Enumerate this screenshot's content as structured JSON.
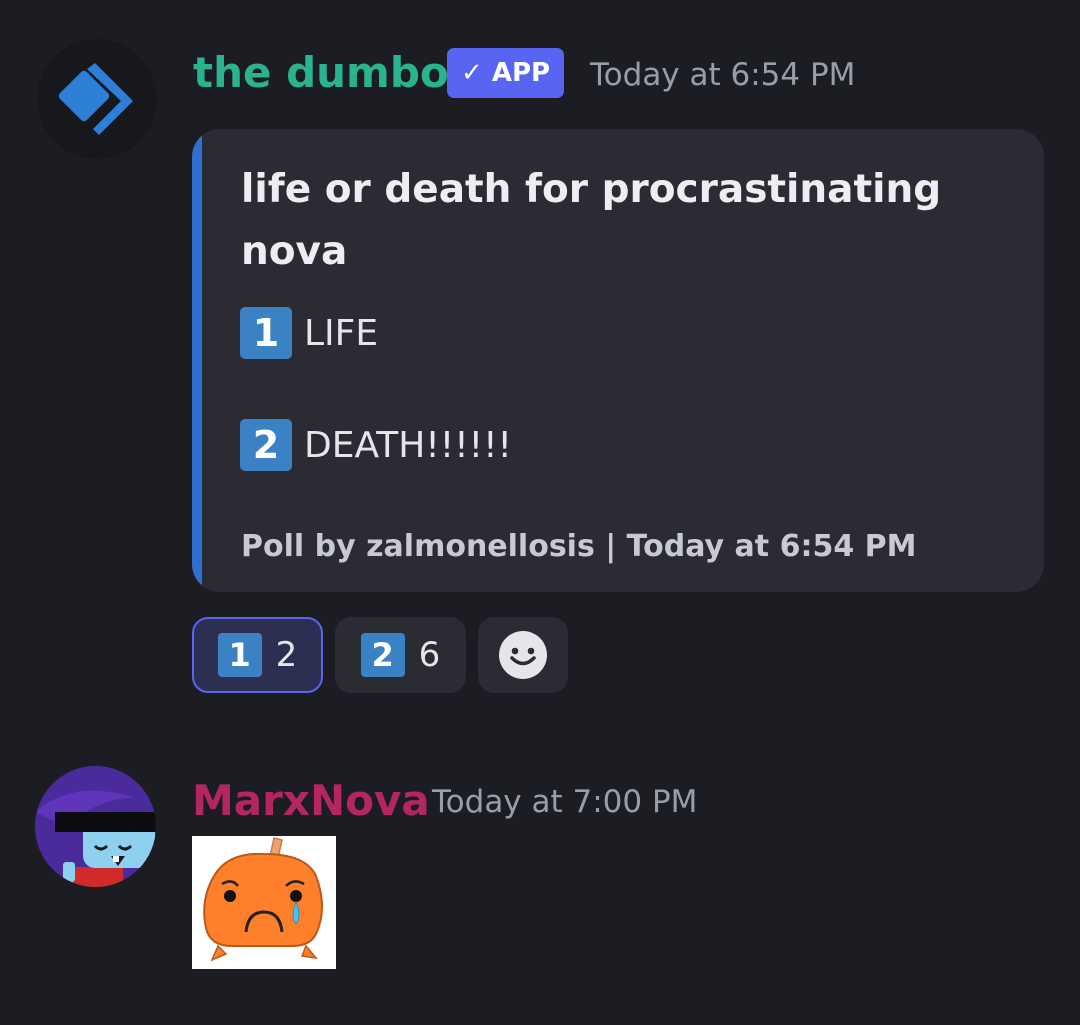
{
  "messages": [
    {
      "author": "the dumbot",
      "author_color": "#2ab391",
      "badge": "APP",
      "badge_icon": "check-icon",
      "timestamp": "Today at 6:54 PM",
      "avatar_icon": "chevron-diamond-icon",
      "embed": {
        "accent_color": "#2f6fd0",
        "title": "life or death for procrastinating nova",
        "options": [
          {
            "keycap": "1",
            "label": "LIFE"
          },
          {
            "keycap": "2",
            "label": "DEATH!!!!!!"
          }
        ],
        "footer": "Poll by zalmonellosis | Today at 6:54 PM"
      },
      "reactions": [
        {
          "keycap": "1",
          "count": "2",
          "selected": true
        },
        {
          "keycap": "2",
          "count": "6",
          "selected": false
        },
        {
          "icon": "add-reaction-smiley-icon"
        }
      ]
    },
    {
      "author": "MarxNova",
      "author_color": "#b3275e",
      "timestamp": "Today at 7:00 PM",
      "avatar_icon": "cartoon-avatar",
      "attachment": {
        "type": "sticker",
        "icon": "crying-orange-blob-sticker"
      }
    }
  ]
}
